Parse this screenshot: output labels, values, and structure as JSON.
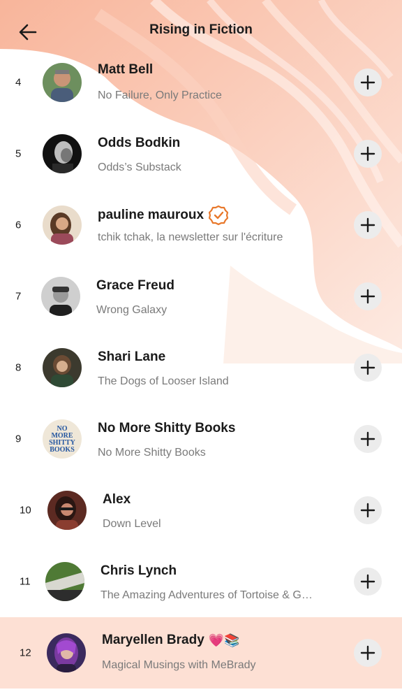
{
  "header": {
    "title": "Rising in Fiction",
    "back_icon": "arrow-left-icon"
  },
  "colors": {
    "accent": "#e8782b",
    "highlight_row": "#fde0d4",
    "button_bg": "#ececec",
    "background_art": "#f9b79a"
  },
  "items": [
    {
      "rank": "4",
      "name": "Matt Bell",
      "publication": "No Failure, Only Practice",
      "avatar": "avatar-matt-bell",
      "action_icon": "plus-icon"
    },
    {
      "rank": "5",
      "name": "Odds Bodkin",
      "publication": "Odds’s Substack",
      "avatar": "avatar-odds-bodkin",
      "action_icon": "plus-icon"
    },
    {
      "rank": "6",
      "name": "pauline mauroux",
      "publication": "tchik tchak, la newsletter sur l'écriture",
      "avatar": "avatar-pauline",
      "verified": true,
      "action_icon": "plus-icon"
    },
    {
      "rank": "7",
      "name": "Grace Freud",
      "publication": "Wrong Galaxy",
      "avatar": "avatar-grace",
      "action_icon": "plus-icon"
    },
    {
      "rank": "8",
      "name": "Shari Lane",
      "publication": "The Dogs of Looser Island",
      "avatar": "avatar-shari",
      "action_icon": "plus-icon"
    },
    {
      "rank": "9",
      "name": "No More Shitty Books",
      "publication": "No More Shitty Books",
      "avatar": "avatar-nmsb",
      "avatar_text": [
        "NO",
        "MORE",
        "SHITTY",
        "BOOKS"
      ],
      "action_icon": "plus-icon"
    },
    {
      "rank": "10",
      "name": "Alex",
      "publication": "Down Level",
      "avatar": "avatar-alex",
      "action_icon": "plus-icon"
    },
    {
      "rank": "11",
      "name": "Chris Lynch",
      "publication": "The Amazing Adventures of Tortoise & G…",
      "avatar": "avatar-chris",
      "action_icon": "plus-icon"
    },
    {
      "rank": "12",
      "name": "Maryellen Brady",
      "name_emoji": "💗📚",
      "publication": "Magical Musings with MeBrady",
      "avatar": "avatar-maryellen",
      "highlighted": true,
      "action_icon": "plus-icon"
    }
  ]
}
